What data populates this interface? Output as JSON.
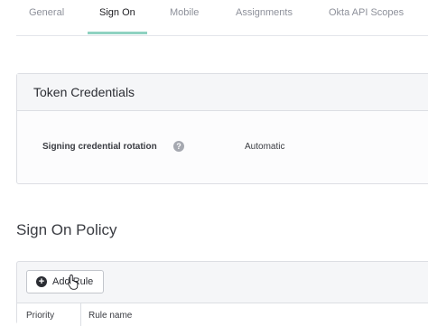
{
  "tabs": [
    {
      "label": "General"
    },
    {
      "label": "Sign On"
    },
    {
      "label": "Mobile"
    },
    {
      "label": "Assignments"
    },
    {
      "label": "Okta API Scopes"
    }
  ],
  "active_tab": "Sign On",
  "token_credentials": {
    "title": "Token Credentials",
    "rows": [
      {
        "label": "Signing credential rotation",
        "help_icon": "?",
        "value": "Automatic"
      }
    ]
  },
  "sign_on_policy": {
    "title": "Sign On Policy",
    "add_rule_label": "Add Rule",
    "columns": [
      "Priority",
      "Rule name"
    ]
  },
  "colors": {
    "active_tab_underline": "#8fd2c1",
    "panel_header_bg": "#f5f6f8",
    "border": "#dcdee3"
  }
}
